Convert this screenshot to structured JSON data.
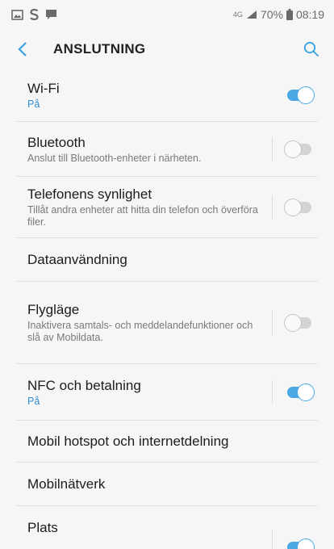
{
  "status_bar": {
    "network": "4G",
    "battery": "70%",
    "time": "08:19"
  },
  "header": {
    "title": "ANSLUTNING"
  },
  "items": [
    {
      "title": "Wi-Fi",
      "subtitle": "På",
      "toggle": true
    },
    {
      "title": "Bluetooth",
      "subtitle": "Anslut till Bluetooth-enheter i närheten.",
      "toggle": false
    },
    {
      "title": "Telefonens synlighet",
      "subtitle": "Tillåt andra enheter att hitta din telefon och överföra filer.",
      "toggle": false
    },
    {
      "title": "Dataanvändning"
    },
    {
      "title": "Flygläge",
      "subtitle": "Inaktivera samtals- och meddelandefunktioner och slå av Mobildata.",
      "toggle": false
    },
    {
      "title": "NFC och betalning",
      "subtitle": "På",
      "toggle": true
    },
    {
      "title": "Mobil hotspot och internetdelning"
    },
    {
      "title": "Mobilnätverk"
    },
    {
      "title": "Plats",
      "toggle": true
    }
  ],
  "colors": {
    "accent": "#4aa9e4",
    "accent_text": "#2f8fd5",
    "icon": "#3aa0e0"
  }
}
